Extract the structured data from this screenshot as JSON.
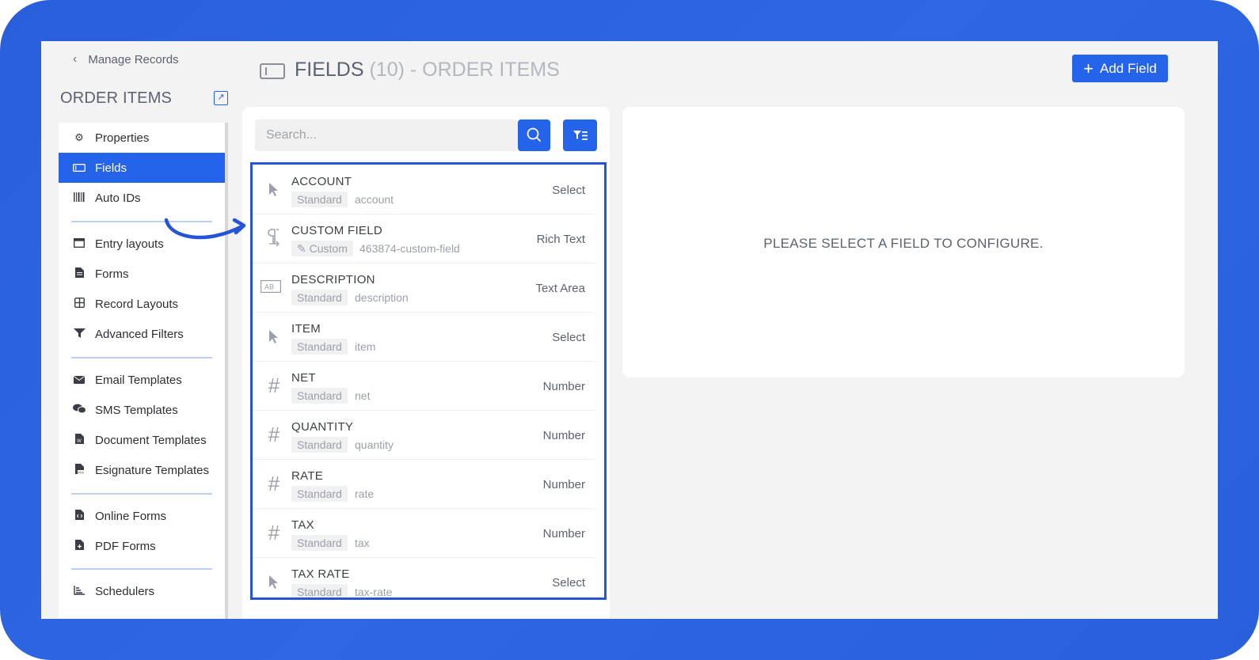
{
  "sidebar": {
    "back_label": "Manage Records",
    "title": "ORDER ITEMS",
    "items": [
      {
        "label": "Properties",
        "icon": "gear-icon"
      },
      {
        "label": "Fields",
        "icon": "field-icon",
        "active": true
      },
      {
        "label": "Auto IDs",
        "icon": "barcode-icon"
      },
      {
        "label": "Entry layouts",
        "icon": "layout-icon"
      },
      {
        "label": "Forms",
        "icon": "document-icon"
      },
      {
        "label": "Record Layouts",
        "icon": "grid-icon"
      },
      {
        "label": "Advanced Filters",
        "icon": "filter-icon"
      },
      {
        "label": "Email Templates",
        "icon": "envelope-icon"
      },
      {
        "label": "SMS Templates",
        "icon": "chat-icon"
      },
      {
        "label": "Document Templates",
        "icon": "word-doc-icon"
      },
      {
        "label": "Esignature Templates",
        "icon": "pdf-doc-icon"
      },
      {
        "label": "Online Forms",
        "icon": "code-doc-icon"
      },
      {
        "label": "PDF Forms",
        "icon": "pdf-add-icon"
      },
      {
        "label": "Schedulers",
        "icon": "chart-icon"
      }
    ]
  },
  "header": {
    "title": "FIELDS",
    "count": "(10)",
    "subtitle": "- ORDER ITEMS",
    "add_button": "Add Field"
  },
  "search": {
    "placeholder": "Search..."
  },
  "fields": [
    {
      "name": "ACCOUNT",
      "badge": "Standard",
      "slug": "account",
      "type": "Select",
      "icon": "cursor-icon"
    },
    {
      "name": "CUSTOM FIELD",
      "badge": "Custom",
      "slug": "463874-custom-field",
      "type": "Rich Text",
      "icon": "pilcrow-icon"
    },
    {
      "name": "DESCRIPTION",
      "badge": "Standard",
      "slug": "description",
      "type": "Text Area",
      "icon": "textarea-icon",
      "icon_text": "AB"
    },
    {
      "name": "ITEM",
      "badge": "Standard",
      "slug": "item",
      "type": "Select",
      "icon": "cursor-icon"
    },
    {
      "name": "NET",
      "badge": "Standard",
      "slug": "net",
      "type": "Number",
      "icon": "hash-icon"
    },
    {
      "name": "QUANTITY",
      "badge": "Standard",
      "slug": "quantity",
      "type": "Number",
      "icon": "hash-icon"
    },
    {
      "name": "RATE",
      "badge": "Standard",
      "slug": "rate",
      "type": "Number",
      "icon": "hash-icon"
    },
    {
      "name": "TAX",
      "badge": "Standard",
      "slug": "tax",
      "type": "Number",
      "icon": "hash-icon"
    },
    {
      "name": "TAX RATE",
      "badge": "Standard",
      "slug": "tax-rate",
      "type": "Select",
      "icon": "cursor-icon"
    }
  ],
  "config": {
    "message": "PLEASE SELECT A FIELD TO CONFIGURE."
  },
  "colors": {
    "accent": "#2563eb",
    "frame": "#2a5fdc",
    "highlight_border": "#2554d6"
  }
}
